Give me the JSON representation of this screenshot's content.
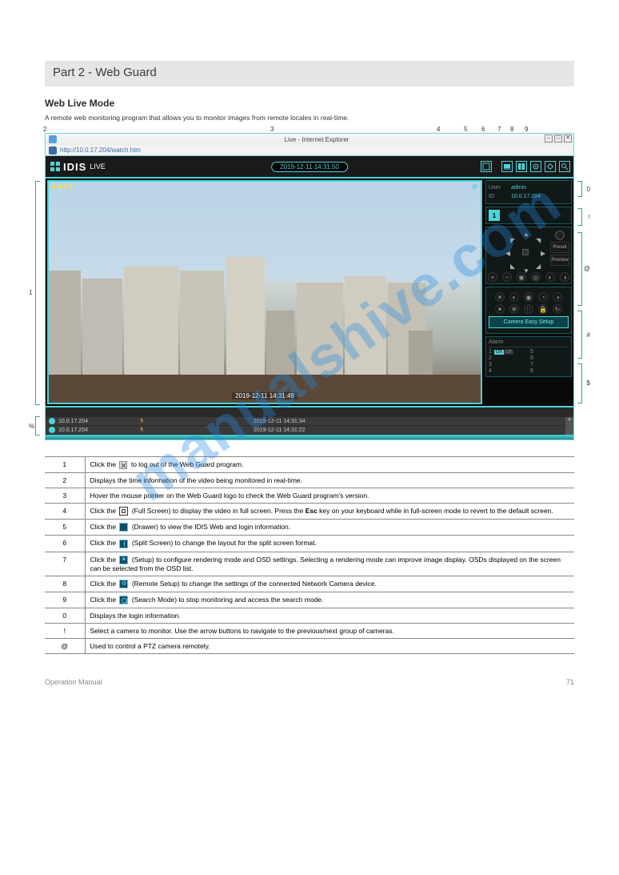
{
  "doc": {
    "header_title": "Part 2 - Web Guard",
    "section_title": "Web Live Mode",
    "section_desc": "A remote web monitoring program that allows you to monitor images from remote locales in real-time.",
    "footer_left": "Operation Manual",
    "footer_right": "71"
  },
  "browser": {
    "window_title": "Live - Internet Explorer",
    "url": "http://10.0.17.204/watch.htm"
  },
  "app": {
    "logo": "IDIS",
    "mode": "LIVE",
    "timestamp": "2019-12-11 14:31:50",
    "toolbar": {
      "fullscreen": "fullscreen",
      "drawer": "drawer",
      "split1": "split-1",
      "split2": "split-2",
      "setup": "setup",
      "remote": "remote-setup",
      "search": "search"
    }
  },
  "video": {
    "osd_topleft": "4-4-4 1",
    "osd_bottom": "2019-12-11 14:31:49",
    "ptz_badge": "P"
  },
  "login": {
    "user_label": "User",
    "user_value": "admin",
    "id_label": "ID",
    "id_value": "10.0.17.204"
  },
  "camera_list": {
    "cam1": "1"
  },
  "ptz": {
    "preset": "Preset",
    "preview": "Preview"
  },
  "easy_setup": "Camera Easy Setup",
  "alarm": {
    "title": "Alarm",
    "on": "On",
    "off": "Off",
    "outs": [
      "1",
      "2",
      "3",
      "4",
      "5",
      "6",
      "7",
      "8"
    ]
  },
  "events": [
    {
      "ip": "10.0.17.204",
      "type": "motion",
      "ts": "2019-12-11 14:31:34"
    },
    {
      "ip": "10.0.17.204",
      "type": "motion",
      "ts": "2019-12-11 14:31:22"
    }
  ],
  "callouts": {
    "top": [
      "2",
      "3",
      "4",
      "5",
      "6",
      "7",
      "8",
      "9"
    ],
    "left": "1",
    "right_top": "0",
    "right_mid1": "!",
    "right_mid2": "@",
    "right_mid3": "#",
    "right_bot": "$",
    "bottom": "%"
  },
  "table": [
    {
      "n": "1",
      "html": "Click the  to log out of the Web Guard program."
    },
    {
      "n": "2",
      "html": "Displays the time information of the video being monitored in real-time."
    },
    {
      "n": "3",
      "html": "Hover the mouse pointer on the Web Guard logo to check the Web Guard program's version."
    },
    {
      "n": "4",
      "html": "Click the  (Full Screen) to display the video in full screen. Press the Esc key on your keyboard  while in full-screen mode to revert to the default screen."
    },
    {
      "n": "5",
      "html": "Click the  (Drawer) to view the IDIS Web and login information."
    },
    {
      "n": "6",
      "html": "Click the  (Split Screen) to change the layout for the split screen format."
    },
    {
      "n": "7",
      "html": "Click the  (Setup) to configure rendering mode and OSD settings. Selecting a rendering mode can improve image display. OSDs displayed on the screen can be selected from the OSD list."
    },
    {
      "n": "8",
      "html": "Click the  (Remote Setup) to change the settings of the connected Network Camera device."
    },
    {
      "n": "9",
      "html": "Click the  (Search Mode) to stop monitoring and access the search mode."
    },
    {
      "n": "0",
      "html": "Displays the login information."
    },
    {
      "n": "!",
      "html": "Select a camera to monitor. Use the arrow buttons to navigate to the previous/next group of cameras."
    },
    {
      "n": "@",
      "html": "Used to control a PTZ camera remotely."
    }
  ],
  "watermark": "manualshive.com"
}
